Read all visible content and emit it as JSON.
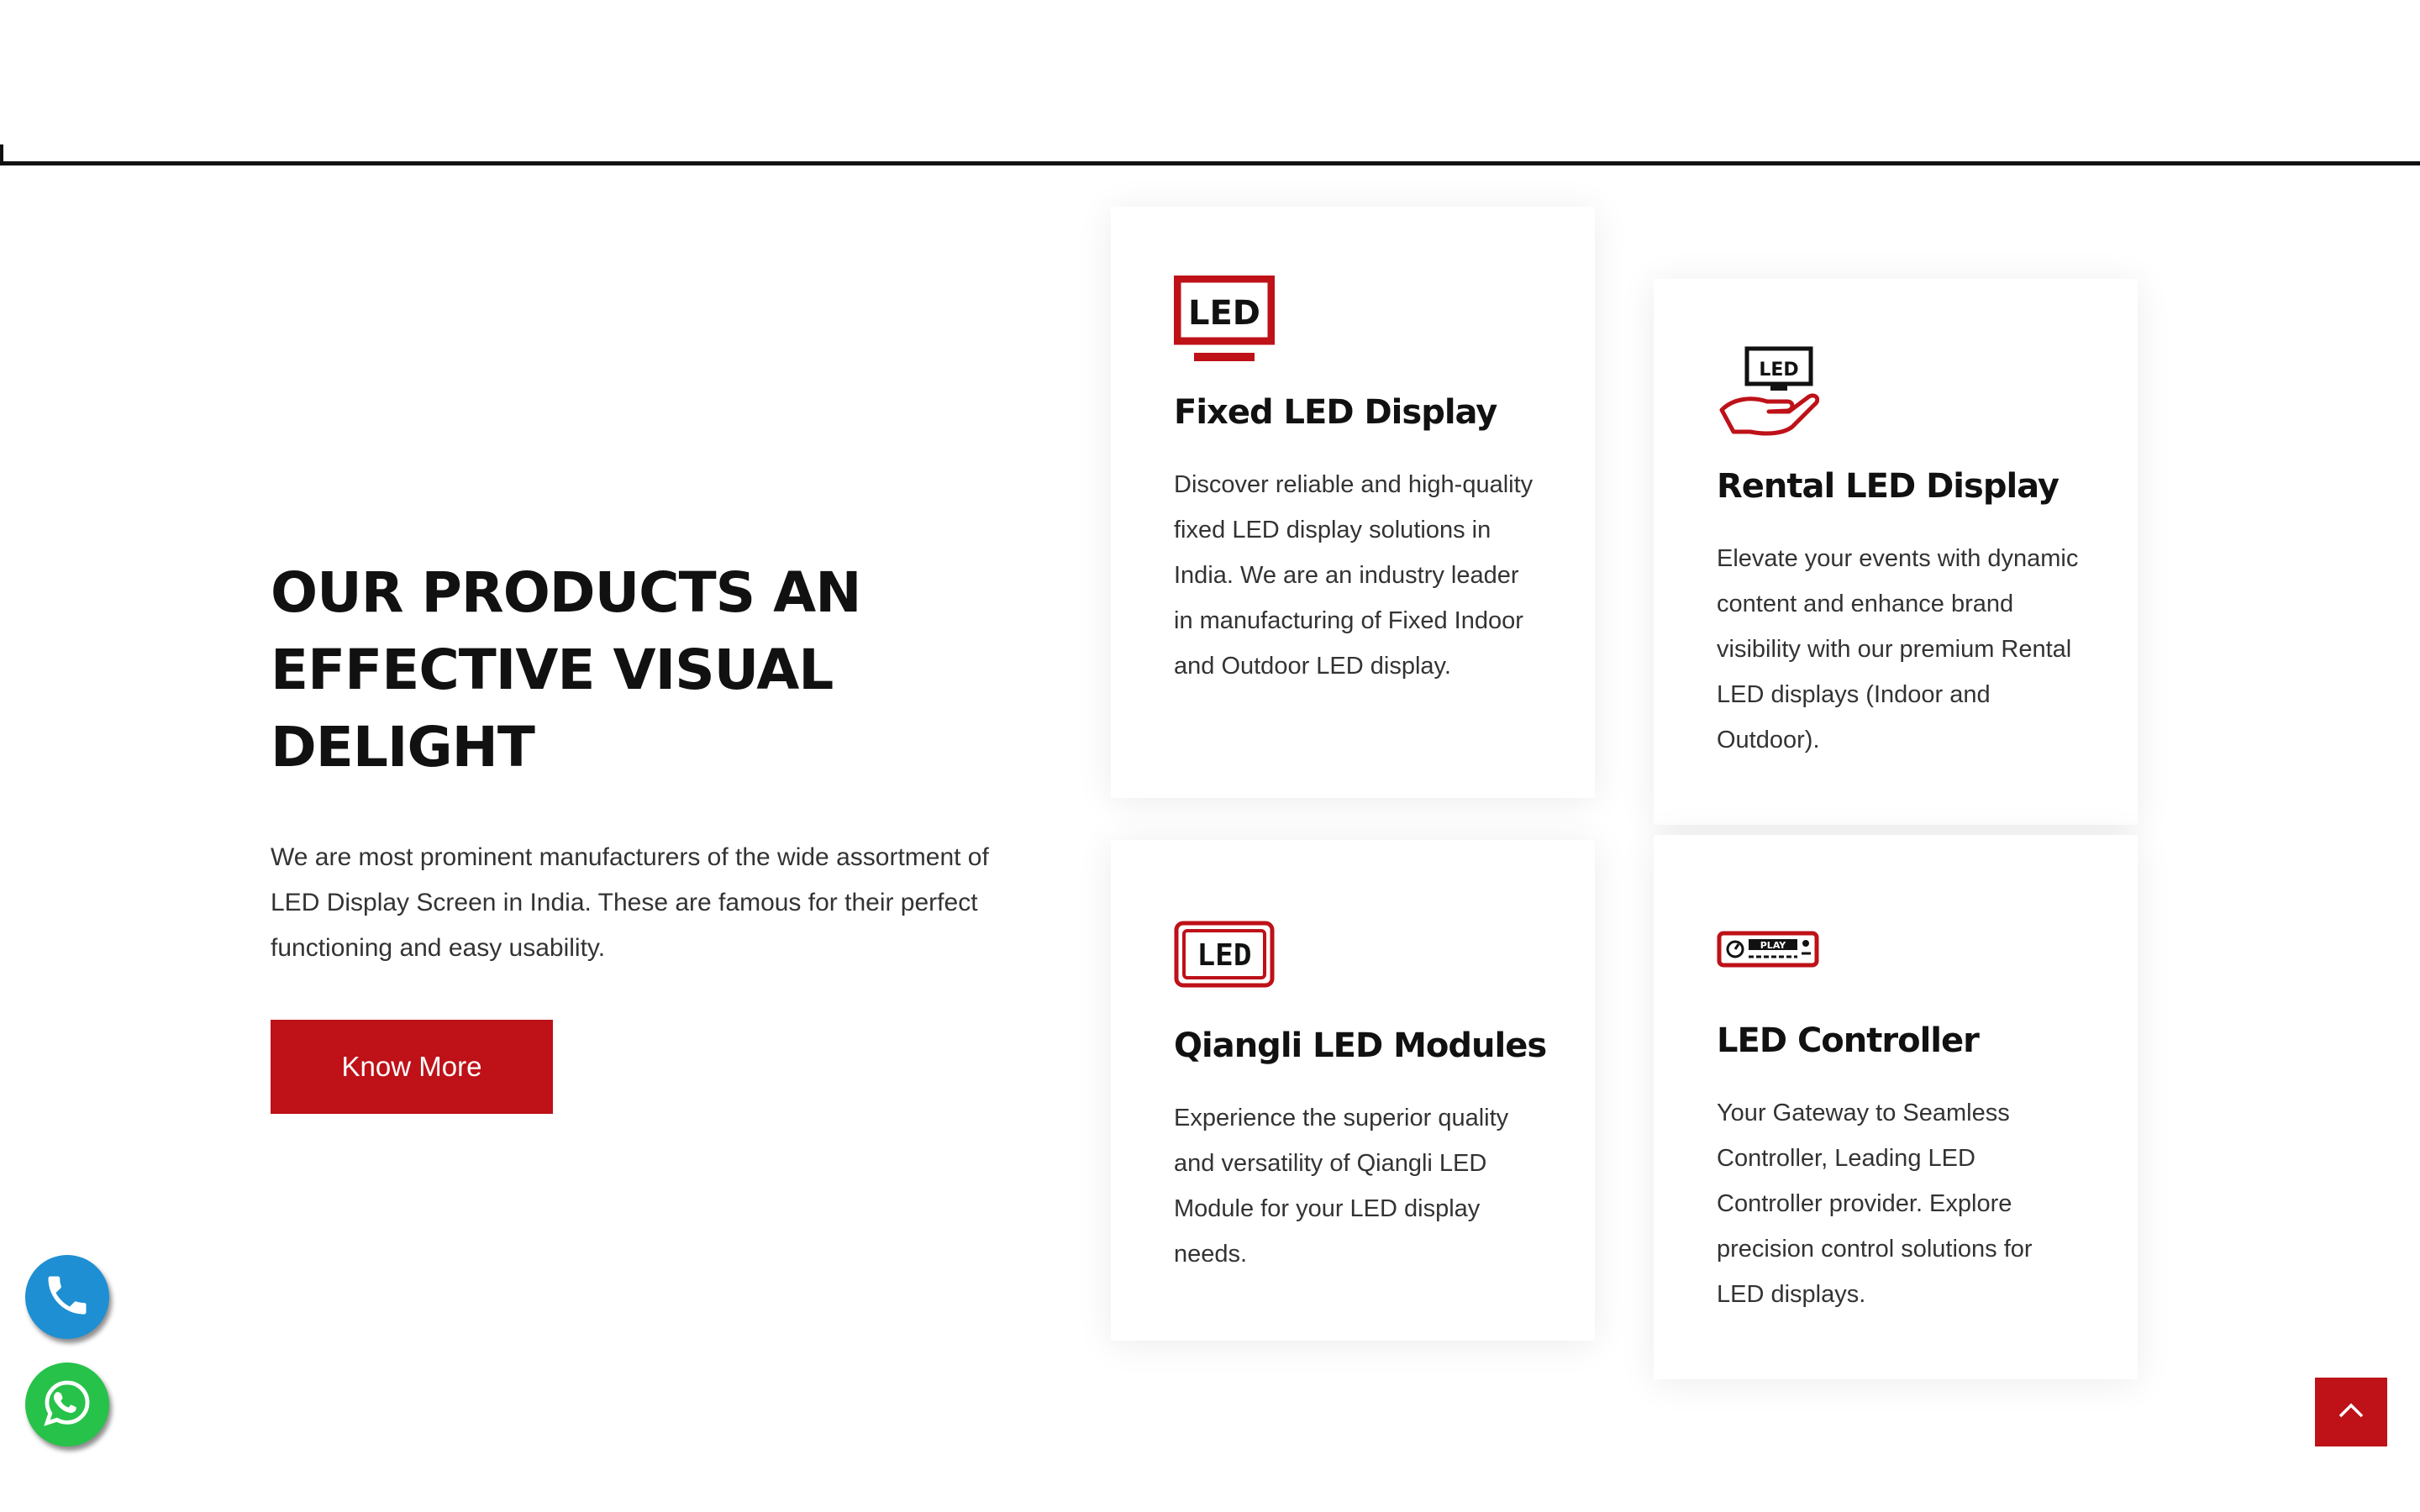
{
  "intro": {
    "title": "OUR PRODUCTS AN EFFECTIVE VISUAL DELIGHT",
    "description": "We are most prominent manufacturers of the wide assortment of LED Display Screen in India. These are famous for their perfect functioning and easy usability.",
    "button_label": "Know More"
  },
  "cards": [
    {
      "icon": "led-monitor-icon",
      "icon_text": "LED",
      "title": "Fixed LED Display",
      "description": "Discover reliable and high-quality fixed LED display solutions in India. We are an industry leader in manufacturing of Fixed Indoor and Outdoor LED display."
    },
    {
      "icon": "led-hand-icon",
      "icon_text": "LED",
      "title": "Rental LED Display",
      "description": "Elevate your events with dynamic content and enhance brand visibility with our premium Rental LED displays (Indoor and Outdoor)."
    },
    {
      "icon": "led-module-icon",
      "icon_text": "LED",
      "title": "Qiangli LED Modules",
      "description": "Experience the superior quality and versatility of Qiangli LED Module for your LED display needs."
    },
    {
      "icon": "led-controller-icon",
      "icon_text": "PLAY",
      "title": "LED Controller",
      "description": "Your Gateway to Seamless Controller, Leading LED Controller provider. Explore precision control solutions for LED displays."
    }
  ],
  "floating": {
    "phone_icon": "phone-icon",
    "whatsapp_icon": "whatsapp-icon",
    "scroll_top_icon": "chevron-up-icon"
  },
  "colors": {
    "accent": "#be1118",
    "phone": "#1e8fd3",
    "whatsapp": "#27c249",
    "heading": "#111111",
    "text": "#333333"
  }
}
